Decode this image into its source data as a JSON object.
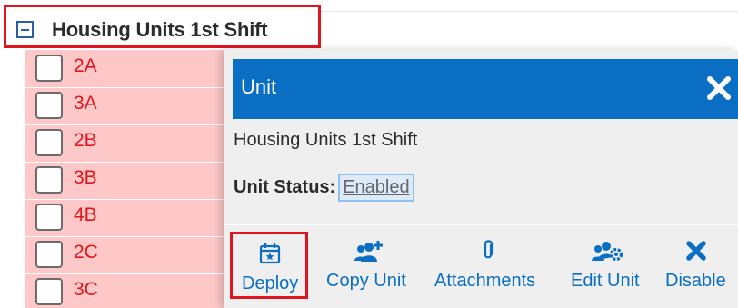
{
  "group": {
    "title": "Housing Units 1st Shift"
  },
  "units": [
    {
      "label": "2A"
    },
    {
      "label": "3A"
    },
    {
      "label": "2B"
    },
    {
      "label": "3B"
    },
    {
      "label": "4B"
    },
    {
      "label": "2C"
    },
    {
      "label": "3C"
    }
  ],
  "popup": {
    "title": "Unit",
    "name": "Housing Units 1st Shift",
    "status_label": "Unit Status:",
    "status_value": "Enabled",
    "actions": {
      "deploy": "Deploy",
      "copy_unit": "Copy Unit",
      "attachments": "Attachments",
      "edit_unit": "Edit Unit",
      "disable": "Disable"
    }
  },
  "colors": {
    "accent_blue": "#0a6fc2",
    "highlight_red": "#e0161e",
    "row_pink": "#ffc8c8"
  },
  "icons": {
    "collapse": "minus-square-icon",
    "close": "close-icon",
    "deploy": "calendar-star-icon",
    "copy_unit": "users-plus-icon",
    "attachments": "paperclip-icon",
    "edit_unit": "users-gear-icon",
    "disable": "x-icon"
  }
}
